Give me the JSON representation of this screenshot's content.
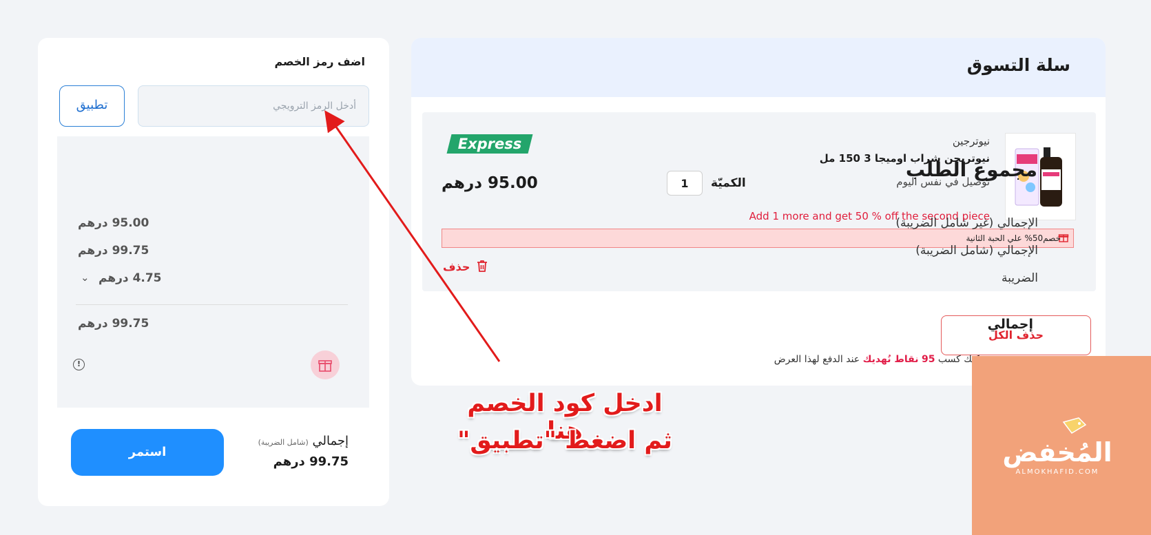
{
  "cart": {
    "title": "سلة التسوق",
    "item": {
      "brand": "نيوترجين",
      "name": "نيوتريجن شراب اوميجا 3 150 مل",
      "delivery": "توصيل في نفس اليوم",
      "badge": "Express",
      "price": "95.00 درهم",
      "quantity_label": "الكميّة",
      "quantity_value": "1",
      "promo_offer": "Add 1 more and get 50 % off the second piece",
      "discount_note": "خصم50% علي الحبة الثانية",
      "delete_label": "حذف"
    },
    "delete_all_label": "حذف الكل"
  },
  "summary": {
    "coupon_title": "اضف رمز الخصم",
    "promo_placeholder": "أدخل الرمز الترويجي",
    "apply_label": "تطبيق",
    "order_title": "مجموع الطلب",
    "rows": [
      {
        "label": "الإجمالي (غير شامل الضريبة)",
        "value": "95.00 درهم"
      },
      {
        "label": "الإجمالي (شامل الضريبة)",
        "value": "99.75 درهم"
      },
      {
        "label": "الضريبة",
        "value": "4.75 درهم"
      }
    ],
    "total_label": "إجمالي",
    "total_value": "99.75 درهم",
    "points": {
      "prefix": "يمكنك كسب",
      "count": "95",
      "highlight": "نقاط نُهديك",
      "suffix": "عند الدفع لهذا العرض"
    },
    "footer": {
      "total_label": "إجمالي",
      "total_note": "(شامل الضريبة)",
      "total_value": "99.75 درهم",
      "continue_label": "استمر"
    }
  },
  "annotation": {
    "line1": "ادخل كود الخصم هنا",
    "line2": "ثم اضغط \"تطبيق\""
  },
  "watermark": {
    "logo": "المُخفض",
    "subtitle": "ALMOKHAFID.COM"
  },
  "colors": {
    "accent": "#1f8fff",
    "danger": "#e0242f",
    "express": "#23a56b",
    "annotation": "#e21b1b"
  },
  "icons": [
    "trash-icon",
    "gift-icon",
    "info-icon",
    "chevron-down-icon"
  ]
}
